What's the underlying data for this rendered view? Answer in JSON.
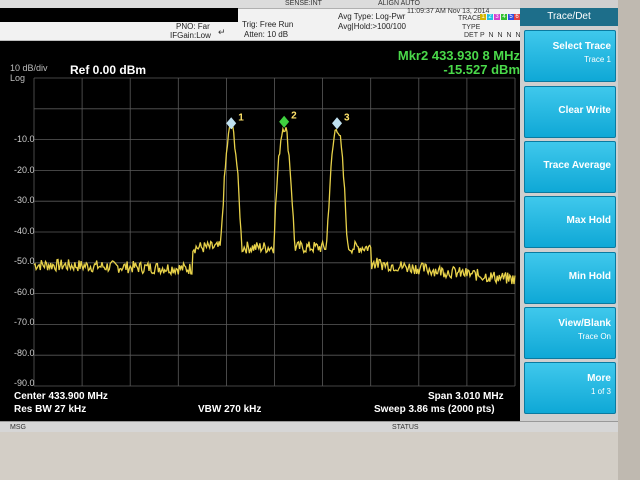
{
  "header": {
    "sense": "SENSE:INT",
    "align": "ALIGN AUTO",
    "pno": "PNO: Far",
    "ifgain": "IFGain:Low",
    "trig": "Trig: Free Run",
    "atten": "Atten: 10 dB",
    "avg_type": "Avg Type: Log-Pwr",
    "avg_hold": "Avg|Hold:>100/100",
    "time": "11:09:37 AM Nov 13, 2014",
    "trace_label": "TRACE",
    "type_label": "TYPE",
    "det_label": "DET",
    "trace_numbers": [
      "1",
      "2",
      "3",
      "4",
      "5",
      "6"
    ],
    "det_letters": "P N N N N N"
  },
  "plot": {
    "scale_top": "10 dB/div",
    "scale_log": "Log",
    "reference": "Ref 0.00 dBm",
    "marker_line1": "Mkr2 433.930 8 MHz",
    "marker_line2": "-15.527 dBm",
    "y_ticks": [
      "-10.0",
      "-20.0",
      "-30.0",
      "-40.0",
      "-50.0",
      "-60.0",
      "-70.0",
      "-80.0",
      "-90.0"
    ],
    "center": "Center 433.900 MHz",
    "res_bw": "Res BW 27 kHz",
    "vbw": "VBW 270 kHz",
    "span": "Span 3.010 MHz",
    "sweep": "Sweep  3.86 ms (2000 pts)"
  },
  "markers": [
    {
      "label": "1"
    },
    {
      "label": "2"
    },
    {
      "label": "3"
    }
  ],
  "status": {
    "msg": "MSG",
    "status": "STATUS"
  },
  "softkeys": {
    "title": "Trace/Det",
    "items": [
      {
        "label": "Select Trace",
        "sub": "Trace 1"
      },
      {
        "label": "Clear Write",
        "sub": ""
      },
      {
        "label": "Trace Average",
        "sub": ""
      },
      {
        "label": "Max Hold",
        "sub": ""
      },
      {
        "label": "Min Hold",
        "sub": ""
      },
      {
        "label": "View/Blank",
        "sub": "Trace On"
      },
      {
        "label": "More",
        "sub": "1 of 3"
      }
    ]
  },
  "colors": {
    "trace": "#e8d24a",
    "marker_active": "#3fd13f",
    "marker_text": "#ffe36a",
    "softkey": "#1fb4e0"
  }
}
